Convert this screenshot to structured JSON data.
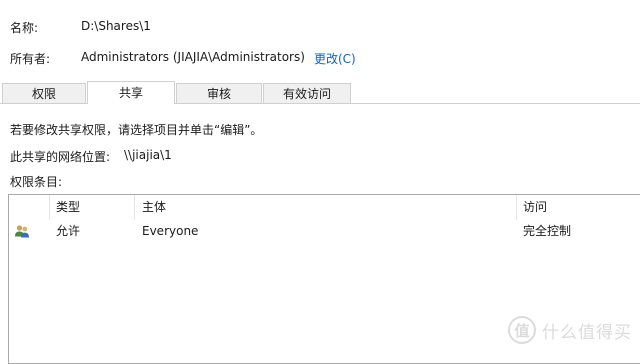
{
  "header": {
    "name_label": "名称:",
    "name_value": "D:\\Shares\\1",
    "owner_label": "所有者:",
    "owner_value": "Administrators (JIAJIA\\Administrators)",
    "change_link": "更改(C)"
  },
  "tabs": [
    {
      "label": "权限",
      "active": false
    },
    {
      "label": "共享",
      "active": true
    },
    {
      "label": "审核",
      "active": false
    },
    {
      "label": "有效访问",
      "active": false
    }
  ],
  "share": {
    "instruction": "若要修改共享权限，请选择项目并单击“编辑”。",
    "network_location_label": "此共享的网络位置:",
    "network_location_value": "\\\\jiajia\\1",
    "entries_label": "权限条目:"
  },
  "list": {
    "columns": [
      "类型",
      "主体",
      "访问"
    ],
    "rows": [
      {
        "type": "允许",
        "principal": "Everyone",
        "access": "完全控制",
        "icon": "users-icon"
      }
    ]
  },
  "watermark": {
    "symbol": "值",
    "text": "什么值得买"
  }
}
